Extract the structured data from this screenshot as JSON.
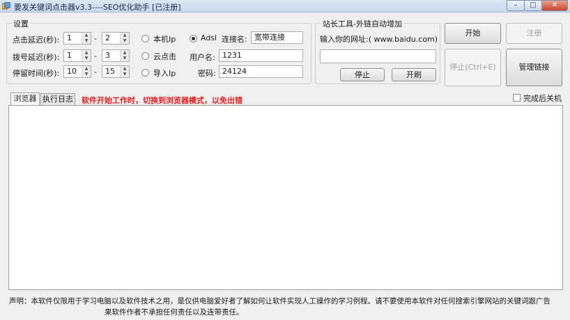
{
  "window": {
    "title": "要发关键词点击器v3.3----SEO优化助手  [已注册]",
    "minimize": "–",
    "maximize": "□",
    "close": "✕"
  },
  "settings": {
    "group_title": "设置",
    "click_delay_label": "点击延迟(秒):",
    "click_delay_from": "1",
    "click_delay_to": "2",
    "dial_delay_label": "拨号延迟(秒):",
    "dial_delay_from": "1",
    "dial_delay_to": "3",
    "stay_time_label": "停留时间(秒):",
    "stay_time_from": "10",
    "stay_time_to": "15",
    "range_sep": "-",
    "mode_local_ip": "本机Ip",
    "mode_cloud_click": "云点击",
    "mode_import_ip": "导入Ip",
    "mode_adsl": "Adsl",
    "connection_name_label": "连接名:",
    "connection_name_value": "宽带连接",
    "username_label": "用户名:",
    "username_value": "1231",
    "password_label": "密码:",
    "password_value": "24124"
  },
  "webmaster": {
    "group_title": "站长工具-外链自动增加",
    "url_prompt": "输入你的网址:( www.baidu.com)",
    "url_value": "",
    "stop_button": "停止",
    "start_button": "开刷"
  },
  "actions": {
    "start": "开始",
    "register": "注册",
    "stop": "停止(Ctrl+E)",
    "manage_links": "管理链接"
  },
  "tabs": {
    "browser": "浏览器",
    "log": "执行日志"
  },
  "notice_warning": "软件开始工作时，切换到浏览器模式，以免出错",
  "shutdown_label": "完成后关机",
  "footer": {
    "line1": "声明：本软件仅限用于学习电脑以及软件技术之用，是仅供电脑爱好者了解如何让软件实现人工操作的学习例程。请不要使用本软件对任何搜索引擎网站的关键词跟广告",
    "line2": "果软件作者不承担任何责任以及连带责任。"
  }
}
